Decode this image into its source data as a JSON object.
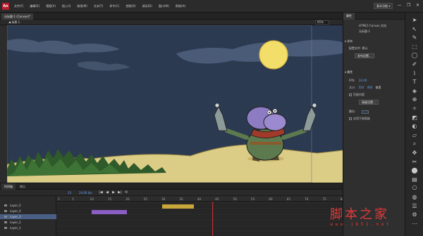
{
  "app": {
    "logo": "An",
    "menu": [
      "文件(F)",
      "编辑(E)",
      "视图(V)",
      "插入(I)",
      "修改(M)",
      "文本(T)",
      "命令(C)",
      "控制(O)",
      "调试(D)",
      "窗口(W)",
      "帮助(H)"
    ],
    "workspace": "基本功能 ▾",
    "window_controls": [
      "—",
      "❐",
      "✕"
    ]
  },
  "document": {
    "tab_label": "无标题-1 (Canvas)*",
    "scene_label": "◀  场景 1",
    "zoom": "65%"
  },
  "properties": {
    "tab": "属性",
    "doc_type": "HTML5 Canvas 文档",
    "doc_name": "无标题-1",
    "publish_section": "▾ 发布",
    "target_label": "配置文件: 默认",
    "publish_settings_button": "发布设置...",
    "properties_section": "▾ 属性",
    "fps_label": "FPS:",
    "fps_value": "24.00",
    "size_label": "大小:",
    "width": "550",
    "height": "400",
    "unit": "像素",
    "match_contents": "匹配内容",
    "advanced_button": "高级设置...",
    "stage_label": "舞台:",
    "stage_color": "#2d3b55",
    "apply_pasteboard": "应用于粘贴板"
  },
  "tools": [
    "➤",
    "↖",
    "✎",
    "⬚",
    "◯",
    "✐",
    "⌇",
    "T",
    "◈",
    "⊕",
    "✧",
    "◩",
    "◐",
    "▱",
    "⌕",
    "✥",
    "✂",
    "⬤",
    "▤",
    "⎔",
    "◍",
    "☰",
    "⚙",
    "⋯"
  ],
  "timeline": {
    "tab": "时间轴",
    "tab2": "输出",
    "frame_number": "23",
    "fps": "24.00 fps",
    "transport": [
      "|◀",
      "◀",
      "▶",
      "▶|",
      "⟲"
    ],
    "ruler_marks": [
      "1",
      "5",
      "10",
      "15",
      "20",
      "25",
      "30",
      "35",
      "40",
      "45",
      "50",
      "55",
      "60",
      "65",
      "70",
      "75",
      "80"
    ],
    "layers": [
      {
        "name": "Layer_5",
        "selected": false
      },
      {
        "name": "Layer_4",
        "selected": false
      },
      {
        "name": "Layer_3",
        "selected": true
      },
      {
        "name": "Layer_2",
        "selected": false
      },
      {
        "name": "Layer_1",
        "selected": false
      }
    ]
  },
  "watermark": {
    "title": "脚本之家",
    "url": "w w w . j b 5 1 . n e t"
  }
}
